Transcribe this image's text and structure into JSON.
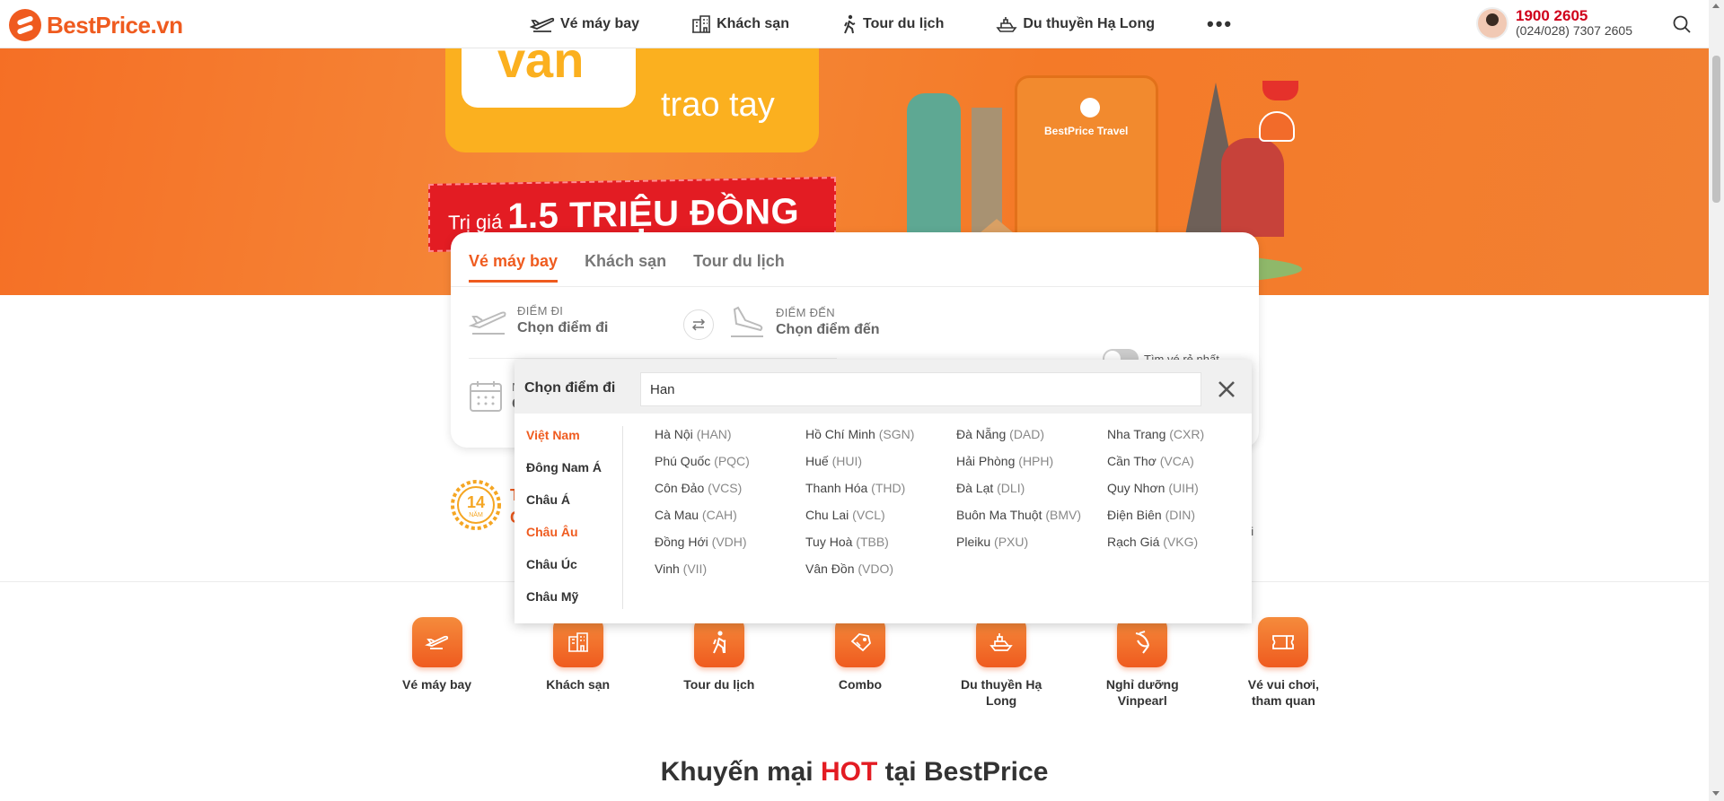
{
  "header": {
    "brand": "BestPrice.vn",
    "nav": [
      {
        "label": "Vé máy bay",
        "icon": "plane-icon"
      },
      {
        "label": "Khách sạn",
        "icon": "hotel-icon"
      },
      {
        "label": "Tour du lịch",
        "icon": "walker-icon"
      },
      {
        "label": "Du thuyền Hạ Long",
        "icon": "boat-icon"
      }
    ],
    "more": "•••",
    "hotline_main": "1900 2605",
    "hotline_sub": "(024/028) 7307 2605"
  },
  "banner": {
    "big_word": "vàn",
    "trao": "trao tay",
    "ribbon_prefix": "Trị giá",
    "ribbon_value": "1.5 TRIỆU ĐỒNG",
    "case_brand": "BestPrice Travel"
  },
  "search_card": {
    "tabs": [
      "Vé máy bay",
      "Khách sạn",
      "Tour du lịch"
    ],
    "from_label": "ĐIỂM ĐI",
    "from_value": "Chọn điểm đi",
    "to_label": "ĐIỂM ĐẾN",
    "to_value": "Chọn điểm đến",
    "date_label": "N",
    "date_value": "C",
    "cheapest_toggle": "Tìm vé rẻ nhất"
  },
  "dropdown": {
    "title": "Chọn điểm đi",
    "input_value": "Han",
    "regions": [
      "Việt Nam",
      "Đông Nam Á",
      "Châu Á",
      "Châu Âu",
      "Châu Úc",
      "Châu Mỹ"
    ],
    "cities": [
      {
        "name": "Hà Nội",
        "code": "(HAN)"
      },
      {
        "name": "Hồ Chí Minh",
        "code": "(SGN)"
      },
      {
        "name": "Đà Nẵng",
        "code": "(DAD)"
      },
      {
        "name": "Nha Trang",
        "code": "(CXR)"
      },
      {
        "name": "Phú Quốc",
        "code": "(PQC)"
      },
      {
        "name": "Huế",
        "code": "(HUI)"
      },
      {
        "name": "Hải Phòng",
        "code": "(HPH)"
      },
      {
        "name": "Cần Thơ",
        "code": "(VCA)"
      },
      {
        "name": "Côn Đảo",
        "code": "(VCS)"
      },
      {
        "name": "Thanh Hóa",
        "code": "(THD)"
      },
      {
        "name": "Đà Lạt",
        "code": "(DLI)"
      },
      {
        "name": "Quy Nhơn",
        "code": "(UIH)"
      },
      {
        "name": "Cà Mau",
        "code": "(CAH)"
      },
      {
        "name": "Chu Lai",
        "code": "(VCL)"
      },
      {
        "name": "Buôn Ma Thuột",
        "code": "(BMV)"
      },
      {
        "name": "Điện Biên",
        "code": "(DIN)"
      },
      {
        "name": "Đồng Hới",
        "code": "(VDH)"
      },
      {
        "name": "Tuy Hoà",
        "code": "(TBB)"
      },
      {
        "name": "Pleiku",
        "code": "(PXU)"
      },
      {
        "name": "Rạch Giá",
        "code": "(VKG)"
      },
      {
        "name": "Vinh",
        "code": "(VII)"
      },
      {
        "name": "Vân Đồn",
        "code": "(VDO)"
      }
    ]
  },
  "behind": {
    "award_number": "14",
    "award_unit": "NĂM",
    "award_text_1": "T",
    "award_text_2": "C",
    "right_text": "ai"
  },
  "services": [
    {
      "label": "Vé máy bay",
      "icon": "plane-icon"
    },
    {
      "label": "Khách sạn",
      "icon": "hotel-icon"
    },
    {
      "label": "Tour du lịch",
      "icon": "walker-icon"
    },
    {
      "label": "Combo",
      "icon": "ticket-icon"
    },
    {
      "label": "Du thuyền Hạ Long",
      "icon": "boat-icon"
    },
    {
      "label": "Nghỉ dưỡng Vinpearl",
      "icon": "leaf-icon"
    },
    {
      "label": "Vé vui chơi, tham quan",
      "icon": "coupon-icon"
    }
  ],
  "promo": {
    "prefix": "Khuyến mại ",
    "hot": "HOT",
    "suffix": " tại BestPrice"
  },
  "colors": {
    "brand": "#ef5b1f",
    "hot_red": "#e31c23"
  }
}
